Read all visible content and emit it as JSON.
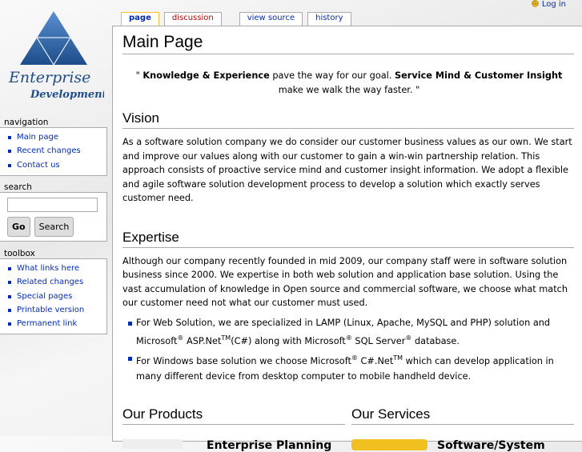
{
  "logo": {
    "line1": "Enterprise",
    "line2": "Development"
  },
  "personal": {
    "login": "Log in"
  },
  "tabs": [
    "page",
    "discussion",
    "view source",
    "history"
  ],
  "page": {
    "title": "Main Page",
    "quote": {
      "open": "\" ",
      "b1": "Knowledge & Experience",
      "t1": " pave the way for our goal. ",
      "b2": "Service Mind & Customer Insight",
      "t2": " make we walk the way faster. \""
    },
    "vision": {
      "heading": "Vision",
      "text": "As a software solution company we do consider our customer business values as our own. We start and improve our values along with our customer to gain a win-win partnership relation. This approach consists of proactive service mind and customer insight information. We adopt a flexible and agile software solution development process to develop a solution which exactly serves customer need."
    },
    "expertise": {
      "heading": "Expertise",
      "text": "Although our company recently founded in mid 2009, our company staff were in software solution business since 2000. We expertise in both web solution and application base solution. Using the vast accumulation of knowledge in Open source and commercial software, we choose what match our customer need not what our customer must used.",
      "b1a": "For Web Solution, we are specialized in LAMP (Linux, Apache, MySQL and PHP) solution and Microsoft",
      "b1b": " ASP.Net",
      "b1c": "(C#) along with Microsoft",
      "b1d": " SQL Server",
      "b1e": " database.",
      "b2a": "For Windows base solution we choose Microsoft",
      "b2b": " C#.Net",
      "b2c": " which can develop application in many different device from desktop computer to mobile handheld device.",
      "reg": "®",
      "tm": "TM"
    },
    "products": {
      "heading": "Our Products",
      "item": "Enterprise Planning"
    },
    "services": {
      "heading": "Our Services",
      "item": "Software/System"
    }
  },
  "navigation": {
    "title": "navigation",
    "items": [
      "Main page",
      "Recent changes",
      "Contact us"
    ]
  },
  "search": {
    "title": "search",
    "placeholder": "",
    "go": "Go",
    "search": "Search"
  },
  "toolbox": {
    "title": "toolbox",
    "items": [
      "What links here",
      "Related changes",
      "Special pages",
      "Printable version",
      "Permanent link"
    ]
  }
}
